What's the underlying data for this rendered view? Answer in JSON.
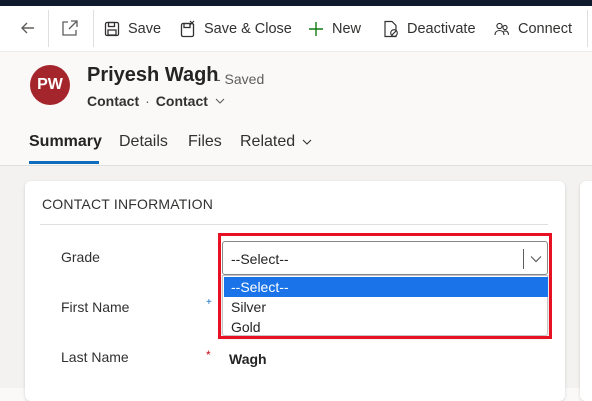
{
  "toolbar": {
    "save_label": "Save",
    "save_close_label": "Save & Close",
    "new_label": "New",
    "deactivate_label": "Deactivate",
    "connect_label": "Connect"
  },
  "record": {
    "initials": "PW",
    "name": "Priyesh Wagh",
    "status": "- Saved",
    "entity": "Contact",
    "form": "Contact",
    "avatar_color": "#a4262c"
  },
  "tabs": [
    {
      "label": "Summary",
      "active": true
    },
    {
      "label": "Details",
      "active": false
    },
    {
      "label": "Files",
      "active": false
    },
    {
      "label": "Related",
      "active": false
    }
  ],
  "section": {
    "title": "CONTACT INFORMATION"
  },
  "fields": {
    "grade": {
      "label": "Grade",
      "value": "--Select--",
      "options": [
        "--Select--",
        "Silver",
        "Gold"
      ],
      "highlighted_option": "--Select--"
    },
    "first_name": {
      "label": "First Name",
      "required_marker": "+"
    },
    "last_name": {
      "label": "Last Name",
      "required_marker": "*",
      "value": "Wagh"
    }
  },
  "colors": {
    "accent": "#0f6cbd",
    "highlight_border": "#e81123",
    "option_selected": "#1a73e8"
  }
}
